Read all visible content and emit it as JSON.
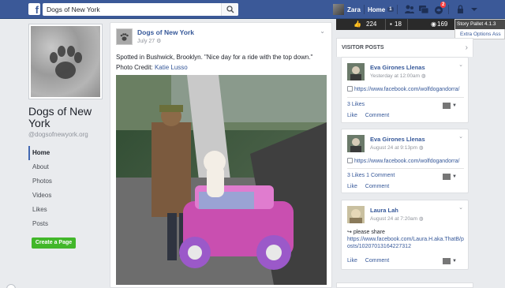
{
  "topbar": {
    "logo": "f",
    "search_value": "Dogs of New York",
    "search_icon": "search-icon",
    "user_name": "Zara",
    "home_label": "Home",
    "home_count": "1",
    "friends_icon": "friends-icon",
    "messages_icon": "messages-icon",
    "notifications_icon": "globe-icon",
    "notification_count": "2",
    "privacy_icon": "privacy-icon",
    "menu_icon": "chevron-down-icon"
  },
  "page": {
    "name": "Dogs of New York",
    "handle": "@dogsofnewyork.org",
    "nav": [
      "Home",
      "About",
      "Photos",
      "Videos",
      "Likes",
      "Posts"
    ],
    "create_button": "Create a Page"
  },
  "post": {
    "author": "Dogs of New York",
    "date": "July 27",
    "text": "Spotted in Bushwick, Brooklyn. \"Nice day for a ride with the top down.\"",
    "credit_label": "Photo Credit:",
    "credit_name": "Katie Lusso"
  },
  "right": {
    "banner": {
      "count_a": "224",
      "count_b": "18",
      "count_c": "169"
    },
    "extension": {
      "title": "Story Pallet  4.1.3",
      "options": "Extra Options    Ass"
    },
    "visitor_posts_title": "VISITOR POSTS",
    "visitor_posts": [
      {
        "name": "Eva Girones Llenas",
        "time": "Yesterday at 12:00am",
        "body": "https://www.facebook.com/wolfdogandorra/",
        "stats": "3 Likes",
        "actions": [
          "Like",
          "Comment"
        ]
      },
      {
        "name": "Eva Girones Llenas",
        "time": "August 24 at 9:13pm",
        "body": "https://www.facebook.com/wolfdogandorra/",
        "stats": "3 Likes   1 Comment",
        "actions": [
          "Like",
          "Comment"
        ]
      },
      {
        "name": "Laura Lah",
        "time": "August 24 at 7:20am",
        "body_prefix": "please share",
        "body": "https://www.facebook.com/Laura.H.aka.ThatB/posts/10207013164227312",
        "actions": [
          "Like",
          "Comment"
        ]
      }
    ]
  },
  "colors": {
    "brand": "#3b5998",
    "link": "#365899",
    "create_button": "#42b72a",
    "background": "#e9ebee"
  }
}
